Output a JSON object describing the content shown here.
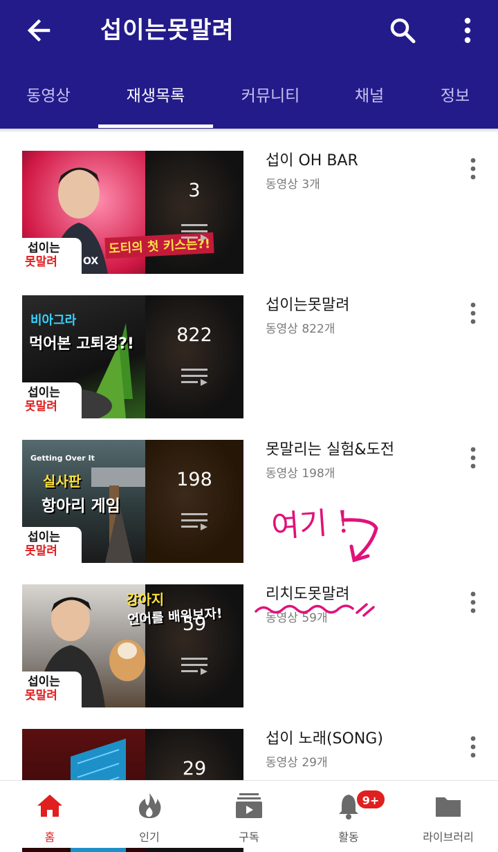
{
  "header": {
    "title": "섭이는못말려",
    "tabs": [
      {
        "label": "동영상",
        "active": false
      },
      {
        "label": "재생목록",
        "active": true
      },
      {
        "label": "커뮤니티",
        "active": false
      },
      {
        "label": "채널",
        "active": false
      },
      {
        "label": "정보",
        "active": false
      }
    ],
    "colors": {
      "appbar": "#231b8a",
      "tab_inactive": "#c7c3ee"
    }
  },
  "playlists": [
    {
      "title": "섭이 OH BAR",
      "subtitle": "동영상 3개",
      "count": "3",
      "thumb_caption": "도티의 첫 키스는?!",
      "thumb_tag": "OX"
    },
    {
      "title": "섭이는못말려",
      "subtitle": "동영상 822개",
      "count": "822",
      "thumb_caption": "먹어본 고퇴경?!",
      "thumb_tag": "비아그라"
    },
    {
      "title": "못말리는 실험&도전",
      "subtitle": "동영상 198개",
      "count": "198",
      "thumb_caption": "항아리 게임",
      "thumb_tag": "실사판",
      "thumb_small": "Getting Over It"
    },
    {
      "title": "리치도못말려",
      "subtitle": "동영상 59개",
      "count": "59",
      "thumb_caption": "언어를 배워보자!",
      "thumb_tag": "강아지"
    },
    {
      "title": "섭이 노래(SONG)",
      "subtitle": "동영상 29개",
      "count": "29"
    }
  ],
  "thumb_logo": {
    "line1": "섭이는",
    "line2": "못말려"
  },
  "annotation": {
    "text": "여기 !",
    "color": "#e0127a"
  },
  "bottom_nav": [
    {
      "label": "홈",
      "icon": "home-icon",
      "active": true
    },
    {
      "label": "인기",
      "icon": "fire-icon",
      "active": false
    },
    {
      "label": "구독",
      "icon": "subscriptions-icon",
      "active": false
    },
    {
      "label": "활동",
      "icon": "bell-icon",
      "active": false,
      "badge": "9+"
    },
    {
      "label": "라이브러리",
      "icon": "folder-icon",
      "active": false
    }
  ]
}
